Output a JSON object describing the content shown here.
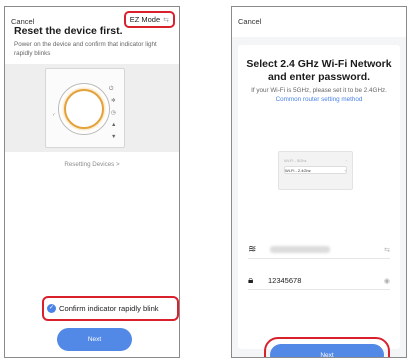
{
  "screen1": {
    "cancel": "Cancel",
    "mode_label": "EZ Mode",
    "mode_icon": "swap-icon",
    "title": "Reset the device first.",
    "subtitle": "Power on the device and confirm that indicator light rapidly blinks",
    "reset_link": "Resetting Devices >",
    "confirm_text": "Confirm indicator rapidly blink",
    "next_label": "Next"
  },
  "screen2": {
    "cancel": "Cancel",
    "title": "Select 2.4 GHz Wi-Fi Network and enter password.",
    "subtitle": "If your Wi-Fi is 5GHz, please set it to be 2.4GHz.",
    "subtitle_link": "Common router setting method",
    "wifi_mini": [
      "Wi-Fi - 5Ghz",
      "Wi-Fi - 2.4Ghz"
    ],
    "password_value": "12345678",
    "next_label": "Next"
  },
  "colors": {
    "accent": "#5288e6",
    "highlight": "#d9212d",
    "link": "#4a83e8"
  }
}
